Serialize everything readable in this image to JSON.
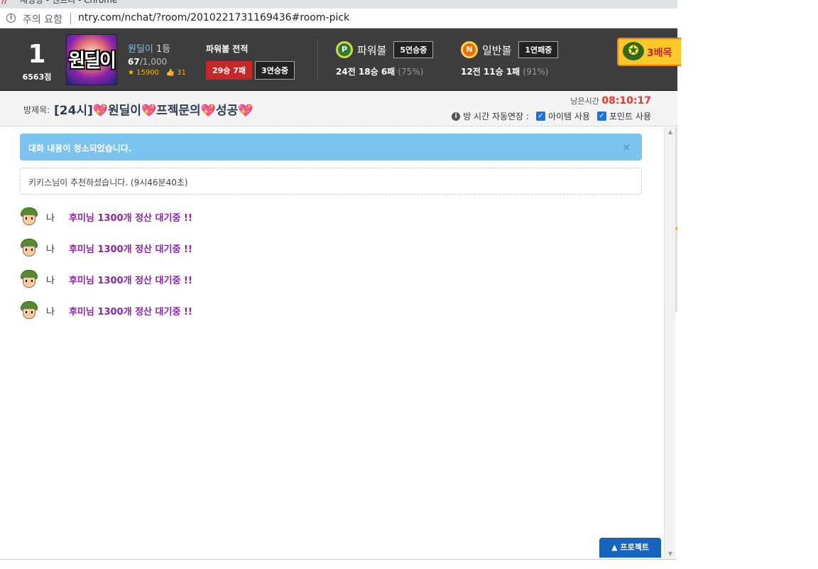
{
  "browser": {
    "title_partial": "채팅방 - 엔트리 - Chrome",
    "security_warning": "주의 요함",
    "url": "ntry.com/nchat/?room/2010221731169436#room-pick"
  },
  "header": {
    "rank": "1",
    "points": "6563점",
    "avatar_text": "원딜이",
    "user_name": "원딜이",
    "user_level": "1등",
    "member_count": "67",
    "member_max": "/1,000",
    "stars": "15900",
    "likes": "31",
    "record_title": "파워볼 전적",
    "record_winloss": "29승 7패",
    "record_streak": "3연승중",
    "powerball": {
      "icon_letter": "P",
      "name": "파워볼",
      "streak": "5연승중",
      "stats_main": "24전 18승 6패",
      "stats_pct": "(75%)"
    },
    "normalball": {
      "icon_letter": "N",
      "name": "일반볼",
      "streak": "1연패중",
      "stats_main": "12전 11승 1패",
      "stats_pct": "(91%)"
    },
    "ribbon_text": "3배목"
  },
  "room": {
    "label": "방제목:",
    "title_parts": [
      "[24시]",
      "원딜이",
      "프젝문의",
      "성공"
    ],
    "timer_label": "남은시간",
    "timer_value": "08:10:17",
    "auto_extend": "방 시간 자동연장 :",
    "item_use": "아이템 사용",
    "point_use": "포인트 사용"
  },
  "chat": {
    "cleared_notice": "대화 내용이 청소되었습니다.",
    "recommend_notice": "키키스님이 추천하셨습니다. (9시46분40초)",
    "messages": [
      {
        "sender": "나",
        "text": "후미님 1300개 정산 대기중 !!"
      },
      {
        "sender": "나",
        "text": "후미님 1300개 정산 대기중 !!"
      },
      {
        "sender": "나",
        "text": "후미님 1300개 정산 대기중 !!"
      },
      {
        "sender": "나",
        "text": "후미님 1300개 정산 대기중 !!"
      }
    ],
    "project_button": "프로젝트"
  },
  "colors": {
    "header_bg": "#3d3d3d",
    "alert_blue": "#7bc4ef",
    "message_purple": "#8e24aa",
    "timer_red": "#e53935",
    "project_blue": "#1565c0"
  }
}
